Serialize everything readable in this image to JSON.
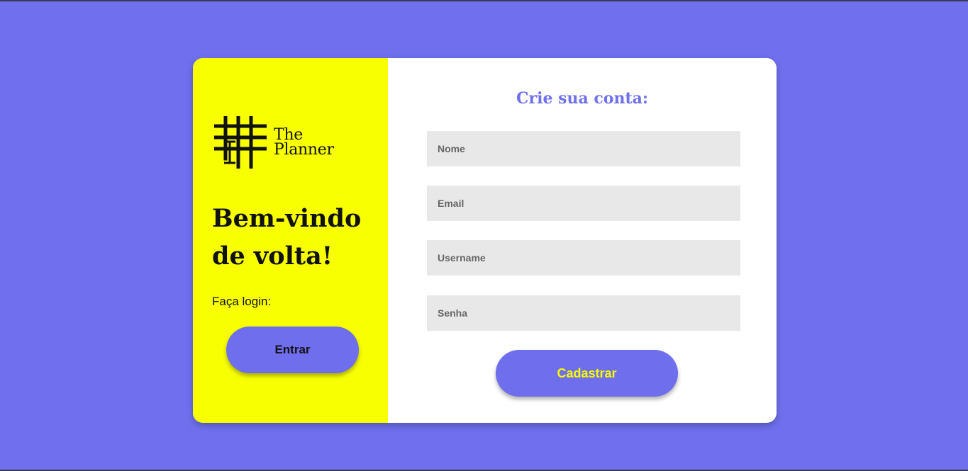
{
  "brand": {
    "logo_line1": "The",
    "logo_line2": "Planner",
    "logo_icon": "hash-grid-icon"
  },
  "left_panel": {
    "welcome_title": "Bem-vindo de volta!",
    "login_prompt": "Faça login:",
    "enter_label": "Entrar"
  },
  "signup_form": {
    "title": "Crie sua conta:",
    "name_placeholder": "Nome",
    "email_placeholder": "Email",
    "username_placeholder": "Username",
    "password_placeholder": "Senha",
    "submit_label": "Cadastrar"
  },
  "colors": {
    "background": "#7070ef",
    "left_panel": "#f7ff00",
    "button": "#6f6eec",
    "submit_text": "#f7ff00",
    "title_text": "#7070ef",
    "input_bg": "#e8e8e8"
  }
}
